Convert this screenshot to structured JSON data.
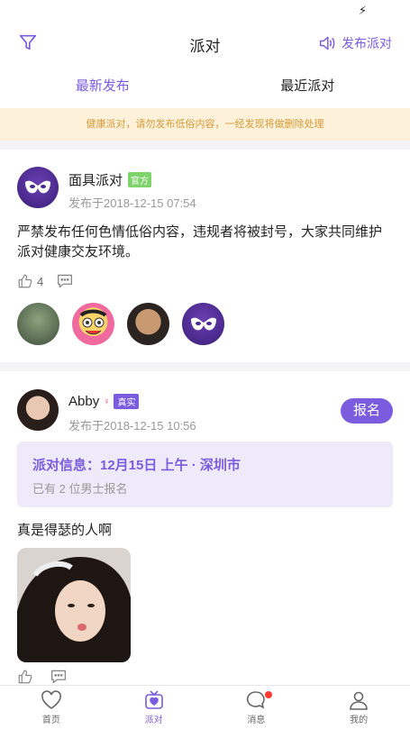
{
  "nav": {
    "title": "派对",
    "publish_label": "发布派对"
  },
  "tabs": {
    "latest": "最新发布",
    "recent": "最近派对"
  },
  "notice": "健康派对，请勿发布低俗内容，一经发现将做删除处理",
  "post1": {
    "author": "面具派对",
    "badge": "官方",
    "time": "发布于2018-12-15 07:54",
    "content": "严禁发布任何色情低俗内容，违规者将被封号，大家共同维护派对健康交友环境。",
    "likes": "4"
  },
  "post2": {
    "author": "Abby",
    "badge": "真实",
    "time": "发布于2018-12-15 10:56",
    "signup": "报名",
    "party_info": "派对信息：12月15日 上午 · 深圳市",
    "party_sub": "已有 2 位男士报名",
    "content": "真是得瑟的人啊"
  },
  "tabbar": {
    "home": "首页",
    "party": "派对",
    "messages": "消息",
    "me": "我的"
  },
  "colors": {
    "accent": "#7b5cde",
    "notice_bg": "#fdf1d9",
    "notice_text": "#d79a3a",
    "official": "#7fd36b"
  }
}
